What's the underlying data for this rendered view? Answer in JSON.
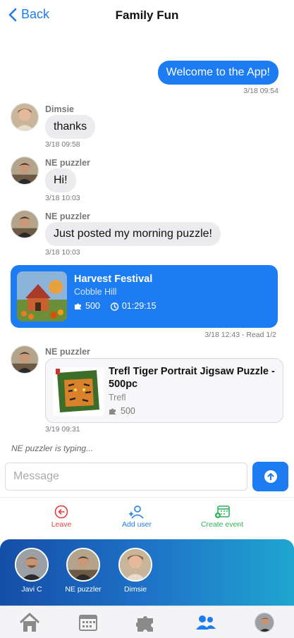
{
  "header": {
    "back_label": "Back",
    "title": "Family Fun"
  },
  "colors": {
    "accent": "#1e7cf2",
    "leave": "#e83b3b",
    "event": "#2eb35a",
    "bubble_in": "#ececef"
  },
  "messages": {
    "m1": {
      "text": "Welcome to the App!",
      "time": "3/18 09:54"
    },
    "m2": {
      "sender": "Dimsie",
      "text": "thanks",
      "time": "3/18 09:58"
    },
    "m3": {
      "sender": "NE puzzler",
      "text": "Hi!",
      "time": "3/18 10:03"
    },
    "m4": {
      "sender": "NE puzzler",
      "text": "Just posted my morning puzzle!",
      "time": "3/18 10:03"
    },
    "m5": {
      "title": "Harvest Festival",
      "brand": "Cobble Hill",
      "pieces": "500",
      "duration": "01:29:15",
      "time": "3/18 12:43 - Read 1/2"
    },
    "m6": {
      "sender": "NE puzzler",
      "title": "Trefl Tiger Portrait Jigsaw Puzzle - 500pc",
      "brand": "Trefl",
      "pieces": "500",
      "time": "3/19 09:31"
    }
  },
  "typing_indicator": "NE puzzler is typing...",
  "composer": {
    "placeholder": "Message",
    "value": ""
  },
  "actions": {
    "leave": "Leave",
    "add_user": "Add user",
    "create_event": "Create event"
  },
  "members": [
    {
      "name": "Javi C"
    },
    {
      "name": "NE puzzler"
    },
    {
      "name": "Dimsie"
    }
  ],
  "tabs": [
    "home-icon",
    "calendar-icon",
    "puzzle-icon",
    "groups-icon",
    "profile-avatar"
  ]
}
